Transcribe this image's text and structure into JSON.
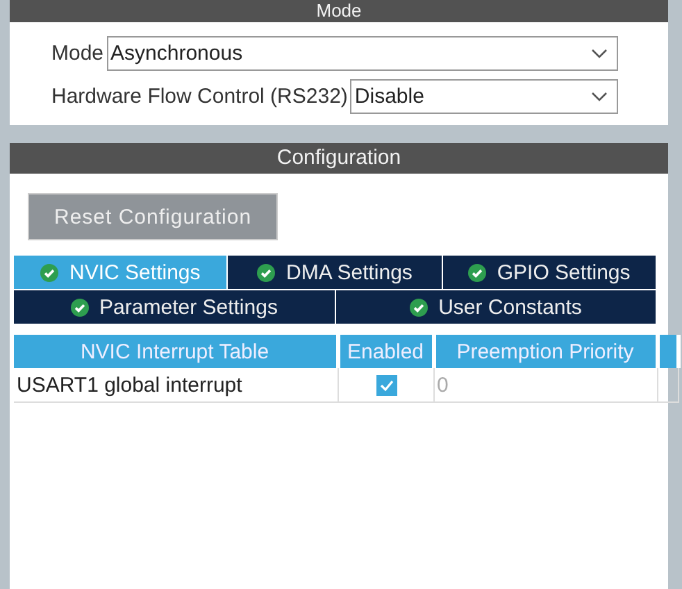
{
  "mode_panel": {
    "title": "Mode",
    "fields": [
      {
        "label": "Mode",
        "value": "Asynchronous"
      },
      {
        "label": "Hardware Flow Control (RS232)",
        "value": "Disable"
      }
    ]
  },
  "configuration_panel": {
    "title": "Configuration",
    "reset_button": "Reset Configuration",
    "tab_rows": [
      [
        {
          "label": "NVIC Settings",
          "selected": true
        },
        {
          "label": "DMA Settings",
          "selected": false
        },
        {
          "label": "GPIO Settings",
          "selected": false
        }
      ],
      [
        {
          "label": "Parameter Settings",
          "selected": false
        },
        {
          "label": "User Constants",
          "selected": false
        }
      ]
    ],
    "table": {
      "columns": [
        "NVIC Interrupt Table",
        "Enabled",
        "Preemption Priority"
      ],
      "rows": [
        {
          "name": "USART1 global interrupt",
          "enabled": true,
          "priority": "0"
        }
      ]
    }
  }
}
